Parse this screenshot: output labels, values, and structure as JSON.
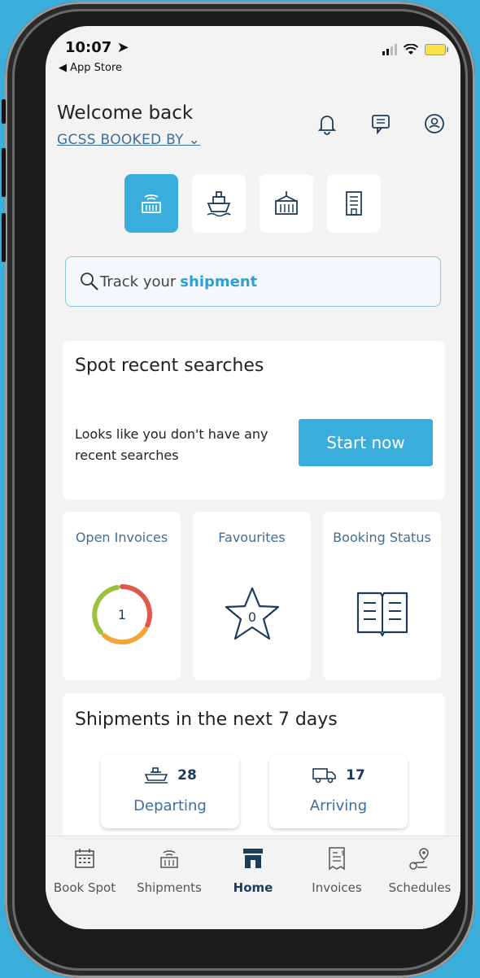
{
  "status_bar": {
    "time": "10:07",
    "back_label": "App Store"
  },
  "header": {
    "welcome": "Welcome back",
    "account": "GCSS BOOKED BY"
  },
  "mode_buttons": [
    "container-icon",
    "vessel-icon",
    "depot-icon",
    "office-icon"
  ],
  "search": {
    "text": "Track your",
    "highlight": "shipment"
  },
  "recent": {
    "title": "Spot recent searches",
    "message": "Looks like you don't have any recent searches",
    "button": "Start now"
  },
  "tiles": {
    "invoices": {
      "label": "Open Invoices",
      "count": "1"
    },
    "favourites": {
      "label": "Favourites",
      "count": "0"
    },
    "booking": {
      "label": "Booking Status"
    }
  },
  "shipments": {
    "title": "Shipments in the next 7 days",
    "departing": {
      "count": "28",
      "label": "Departing"
    },
    "arriving": {
      "count": "17",
      "label": "Arriving"
    }
  },
  "tabs": [
    {
      "label": "Book Spot",
      "icon": "calendar-icon"
    },
    {
      "label": "Shipments",
      "icon": "container-icon"
    },
    {
      "label": "Home",
      "icon": "home-icon",
      "active": true
    },
    {
      "label": "Invoices",
      "icon": "invoice-icon"
    },
    {
      "label": "Schedules",
      "icon": "route-icon"
    }
  ],
  "colors": {
    "accent": "#3aaedb",
    "navy": "#1d3c5c",
    "link": "#3d6f9a"
  }
}
